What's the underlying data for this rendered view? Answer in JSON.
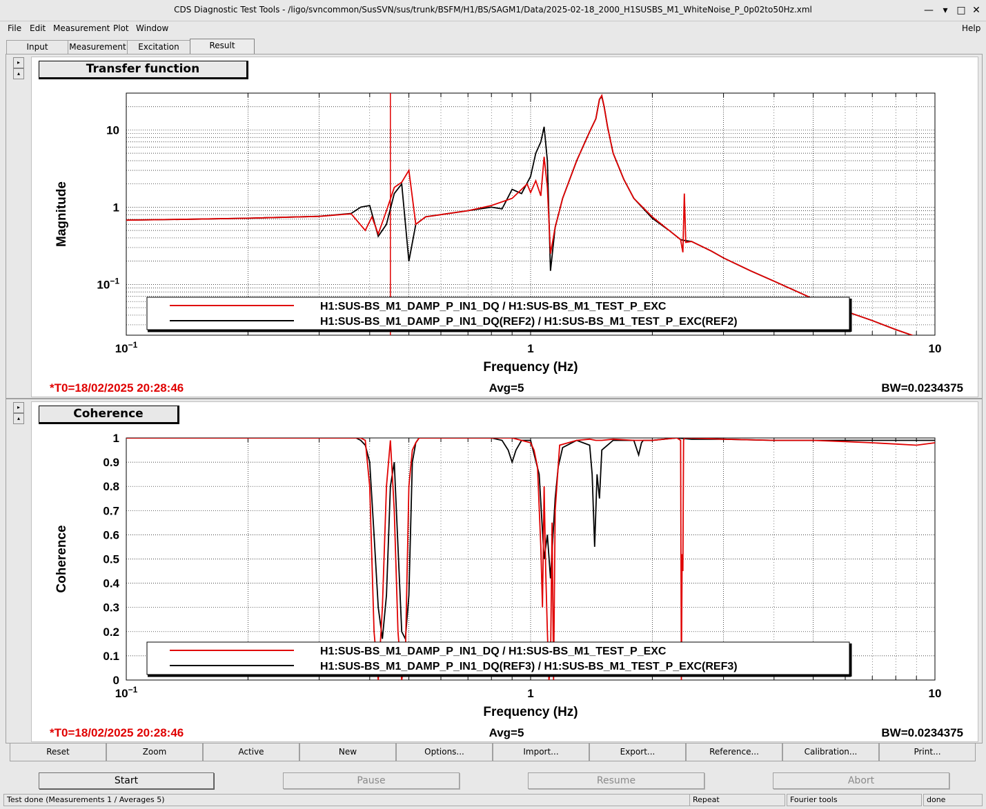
{
  "window": {
    "title": "CDS Diagnostic Test Tools - /ligo/svncommon/SusSVN/sus/trunk/BSFM/H1/BS/SAGM1/Data/2025-02-18_2000_H1SUSBS_M1_WhiteNoise_P_0p02to50Hz.xml",
    "minimize": "—",
    "maximize": "□",
    "close": "✕"
  },
  "menu": {
    "file": "File",
    "edit": "Edit",
    "measurement": "Measurement",
    "plot": "Plot",
    "window": "Window",
    "help": "Help"
  },
  "tabs": {
    "input": "Input",
    "measurement": "Measurement",
    "excitation": "Excitation",
    "result": "Result"
  },
  "plots": {
    "tf": {
      "title": "Transfer function",
      "t0": "*T0=18/02/2025 20:28:46",
      "avg": "Avg=5",
      "bw": "BW=0.0234375"
    },
    "coh": {
      "title": "Coherence",
      "t0": "*T0=18/02/2025 20:28:46",
      "avg": "Avg=5",
      "bw": "BW=0.0234375"
    }
  },
  "chart_data": [
    {
      "type": "line",
      "title": "Transfer function",
      "xlabel": "Frequency (Hz)",
      "ylabel": "Magnitude",
      "xscale": "log",
      "yscale": "log",
      "xlim": [
        0.1,
        10
      ],
      "ylim": [
        0.022,
        30
      ],
      "grid": true,
      "legend_position": "bottom-center",
      "cursor_x": 0.45,
      "x_ticks": [
        {
          "v": 0.1,
          "b": "10",
          "e": "−1"
        },
        {
          "v": 1,
          "b": "1",
          "e": ""
        },
        {
          "v": 10,
          "b": "10",
          "e": ""
        }
      ],
      "y_ticks": [
        {
          "v": 10,
          "b": "10",
          "e": ""
        },
        {
          "v": 1,
          "b": "1",
          "e": ""
        },
        {
          "v": 0.1,
          "b": "10",
          "e": "−1"
        }
      ],
      "series": [
        {
          "name": "H1:SUS-BS_M1_DAMP_P_IN1_DQ / H1:SUS-BS_M1_TEST_P_EXC",
          "color": "#e00000",
          "x": [
            0.1,
            0.15,
            0.2,
            0.3,
            0.36,
            0.39,
            0.405,
            0.42,
            0.44,
            0.46,
            0.48,
            0.5,
            0.52,
            0.55,
            0.6,
            0.7,
            0.8,
            0.9,
            0.95,
            0.98,
            1.0,
            1.03,
            1.06,
            1.08,
            1.1,
            1.12,
            1.15,
            1.2,
            1.3,
            1.4,
            1.45,
            1.48,
            1.5,
            1.52,
            1.55,
            1.6,
            1.7,
            1.8,
            2.0,
            2.2,
            2.35,
            2.38,
            2.4,
            2.42,
            2.5,
            2.8,
            3.0,
            3.5,
            4.0,
            5.0,
            6.0,
            7.0,
            8.0,
            9.0,
            10.0
          ],
          "y": [
            0.68,
            0.7,
            0.72,
            0.76,
            0.82,
            0.5,
            0.75,
            0.45,
            0.9,
            1.8,
            2.1,
            3.0,
            0.6,
            0.75,
            0.8,
            0.9,
            1.05,
            1.3,
            1.7,
            2.0,
            1.55,
            2.2,
            1.4,
            4.5,
            1.8,
            0.25,
            0.55,
            1.3,
            4.0,
            9.5,
            14,
            25,
            28,
            20,
            11,
            5.0,
            2.3,
            1.3,
            0.75,
            0.5,
            0.38,
            0.26,
            1.5,
            0.35,
            0.36,
            0.27,
            0.22,
            0.15,
            0.11,
            0.065,
            0.045,
            0.034,
            0.026,
            0.021,
            0.018
          ]
        },
        {
          "name": "H1:SUS-BS_M1_DAMP_P_IN1_DQ(REF2) / H1:SUS-BS_M1_TEST_P_EXC(REF2)",
          "color": "#000000",
          "x": [
            0.1,
            0.15,
            0.2,
            0.3,
            0.36,
            0.38,
            0.4,
            0.42,
            0.44,
            0.46,
            0.48,
            0.5,
            0.52,
            0.55,
            0.6,
            0.7,
            0.8,
            0.85,
            0.9,
            0.95,
            1.0,
            1.03,
            1.06,
            1.08,
            1.1,
            1.12,
            1.15,
            1.2,
            1.3,
            1.4,
            1.45,
            1.48,
            1.5,
            1.52,
            1.55,
            1.6,
            1.7,
            1.8,
            2.0,
            2.2,
            2.35,
            2.4,
            2.5,
            2.8,
            3.0,
            3.5,
            4.0,
            5.0,
            6.0,
            7.0,
            8.0,
            9.0,
            10.0
          ],
          "y": [
            0.68,
            0.7,
            0.72,
            0.76,
            0.83,
            1.0,
            1.05,
            0.42,
            0.6,
            1.5,
            2.0,
            0.2,
            0.6,
            0.75,
            0.8,
            0.9,
            1.0,
            0.95,
            1.7,
            1.5,
            2.5,
            5.0,
            7.0,
            11,
            4.0,
            0.15,
            0.55,
            1.3,
            4.0,
            9.5,
            14,
            25,
            27,
            20,
            11,
            5.0,
            2.3,
            1.3,
            0.72,
            0.5,
            0.38,
            0.37,
            0.36,
            0.27,
            0.22,
            0.15,
            0.11,
            0.065,
            0.045,
            0.034,
            0.026,
            0.021,
            0.018
          ]
        }
      ]
    },
    {
      "type": "line",
      "title": "Coherence",
      "xlabel": "Frequency (Hz)",
      "ylabel": "Coherence",
      "xscale": "log",
      "yscale": "linear",
      "xlim": [
        0.1,
        10
      ],
      "ylim": [
        0,
        1
      ],
      "grid": true,
      "legend_position": "bottom-center",
      "x_ticks": [
        {
          "v": 0.1,
          "b": "10",
          "e": "−1"
        },
        {
          "v": 1,
          "b": "1",
          "e": ""
        },
        {
          "v": 10,
          "b": "10",
          "e": ""
        }
      ],
      "y_ticks": [
        {
          "v": 1,
          "b": "1",
          "e": ""
        },
        {
          "v": 0.9,
          "b": "0.9",
          "e": ""
        },
        {
          "v": 0.8,
          "b": "0.8",
          "e": ""
        },
        {
          "v": 0.7,
          "b": "0.7",
          "e": ""
        },
        {
          "v": 0.6,
          "b": "0.6",
          "e": ""
        },
        {
          "v": 0.5,
          "b": "0.5",
          "e": ""
        },
        {
          "v": 0.4,
          "b": "0.4",
          "e": ""
        },
        {
          "v": 0.3,
          "b": "0.3",
          "e": ""
        },
        {
          "v": 0.2,
          "b": "0.2",
          "e": ""
        },
        {
          "v": 0.1,
          "b": "0.1",
          "e": ""
        },
        {
          "v": 0,
          "b": "0",
          "e": ""
        }
      ],
      "series": [
        {
          "name": "H1:SUS-BS_M1_DAMP_P_IN1_DQ / H1:SUS-BS_M1_TEST_P_EXC",
          "color": "#e00000",
          "x": [
            0.1,
            0.3,
            0.38,
            0.39,
            0.4,
            0.41,
            0.42,
            0.43,
            0.44,
            0.45,
            0.46,
            0.47,
            0.48,
            0.49,
            0.5,
            0.51,
            0.52,
            0.53,
            0.55,
            0.6,
            0.8,
            0.9,
            0.95,
            1.0,
            1.02,
            1.04,
            1.06,
            1.07,
            1.08,
            1.09,
            1.1,
            1.11,
            1.12,
            1.13,
            1.14,
            1.15,
            1.18,
            1.3,
            1.4,
            1.45,
            1.5,
            1.6,
            1.8,
            2.0,
            2.3,
            2.35,
            2.36,
            2.37,
            2.38,
            2.39,
            2.4,
            2.5,
            3.0,
            4.0,
            5.0,
            6.0,
            7.0,
            8.0,
            9.0,
            10.0
          ],
          "y": [
            1,
            1,
            1,
            0.99,
            0.8,
            0.2,
            0.0,
            0.3,
            0.8,
            0.99,
            0.7,
            0.2,
            0.0,
            0.1,
            0.8,
            0.95,
            0.98,
            1.0,
            1.0,
            1.0,
            1.0,
            1.0,
            0.99,
            0.98,
            0.95,
            0.88,
            0.55,
            0.3,
            0.8,
            0.45,
            0.2,
            0.0,
            0.05,
            0.65,
            0.0,
            0.7,
            0.97,
            0.99,
            0.995,
            0.99,
            0.99,
            0.995,
            0.99,
            0.99,
            1.0,
            0.99,
            0.0,
            0.52,
            0.45,
            0.99,
            1.0,
            1.0,
            0.995,
            0.99,
            0.99,
            0.985,
            0.98,
            0.975,
            0.97,
            0.98
          ]
        },
        {
          "name": "H1:SUS-BS_M1_DAMP_P_IN1_DQ(REF3) / H1:SUS-BS_M1_TEST_P_EXC(REF3)",
          "color": "#000000",
          "x": [
            0.1,
            0.3,
            0.37,
            0.38,
            0.39,
            0.4,
            0.41,
            0.42,
            0.43,
            0.44,
            0.45,
            0.46,
            0.47,
            0.48,
            0.49,
            0.5,
            0.51,
            0.52,
            0.53,
            0.55,
            0.6,
            0.8,
            0.85,
            0.88,
            0.9,
            0.92,
            0.95,
            1.0,
            1.05,
            1.08,
            1.1,
            1.12,
            1.15,
            1.17,
            1.2,
            1.3,
            1.4,
            1.42,
            1.44,
            1.46,
            1.48,
            1.5,
            1.6,
            1.8,
            1.85,
            1.88,
            1.9,
            2.0,
            2.3,
            2.5,
            3.0,
            4.0,
            5.0,
            6.0,
            7.0,
            8.0,
            9.0,
            10.0
          ],
          "y": [
            1,
            1,
            1,
            0.99,
            0.97,
            0.9,
            0.6,
            0.3,
            0.17,
            0.35,
            0.8,
            0.9,
            0.55,
            0.2,
            0.17,
            0.35,
            0.9,
            0.98,
            1.0,
            1.0,
            1.0,
            1.0,
            0.99,
            0.95,
            0.9,
            0.95,
            0.99,
            0.99,
            0.85,
            0.5,
            0.6,
            0.42,
            0.75,
            0.88,
            0.96,
            0.99,
            0.97,
            0.85,
            0.55,
            0.85,
            0.75,
            0.95,
            0.99,
            0.99,
            0.93,
            0.98,
            0.99,
            0.99,
            1.0,
            0.995,
            0.995,
            0.99,
            0.99,
            0.99,
            0.99,
            0.99,
            0.99,
            0.99
          ]
        }
      ]
    }
  ],
  "buttons": [
    "Reset",
    "Zoom",
    "Active",
    "New",
    "Options...",
    "Import...",
    "Export...",
    "Reference...",
    "Calibration...",
    "Print..."
  ],
  "control": {
    "start": "Start",
    "pause": "Pause",
    "resume": "Resume",
    "abort": "Abort"
  },
  "status": {
    "message": "Test done (Measurements 1 / Averages 5)",
    "repeat": "Repeat",
    "fourier": "Fourier tools",
    "state": "done"
  }
}
